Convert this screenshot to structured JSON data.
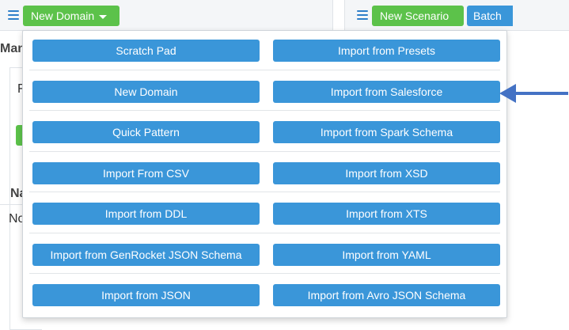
{
  "toolbar": {
    "new_domain_label": "New Domain",
    "new_scenario_label": "New Scenario",
    "batch_label": "Batch"
  },
  "background": {
    "man_text": "Man",
    "f_text": "F",
    "na_text": "Na",
    "no_text": "No"
  },
  "menu": {
    "left": [
      "Scratch Pad",
      "New Domain",
      "Quick Pattern",
      "Import From CSV",
      "Import from DDL",
      "Import from GenRocket JSON Schema",
      "Import from JSON"
    ],
    "right": [
      "Import from Presets",
      "Import from Salesforce",
      "Import from Spark Schema",
      "Import from XSD",
      "Import from XTS",
      "Import from YAML",
      "Import from Avro JSON Schema"
    ]
  },
  "colors": {
    "menu_button": "#3a96d9",
    "green_button": "#5cc24a",
    "arrow": "#4472c4",
    "hamburger": "#2f7fc9"
  },
  "icons": {
    "hamburger": "hamburger-menu-icon",
    "caret": "caret-down-icon",
    "arrow": "left-arrow-pointer"
  }
}
